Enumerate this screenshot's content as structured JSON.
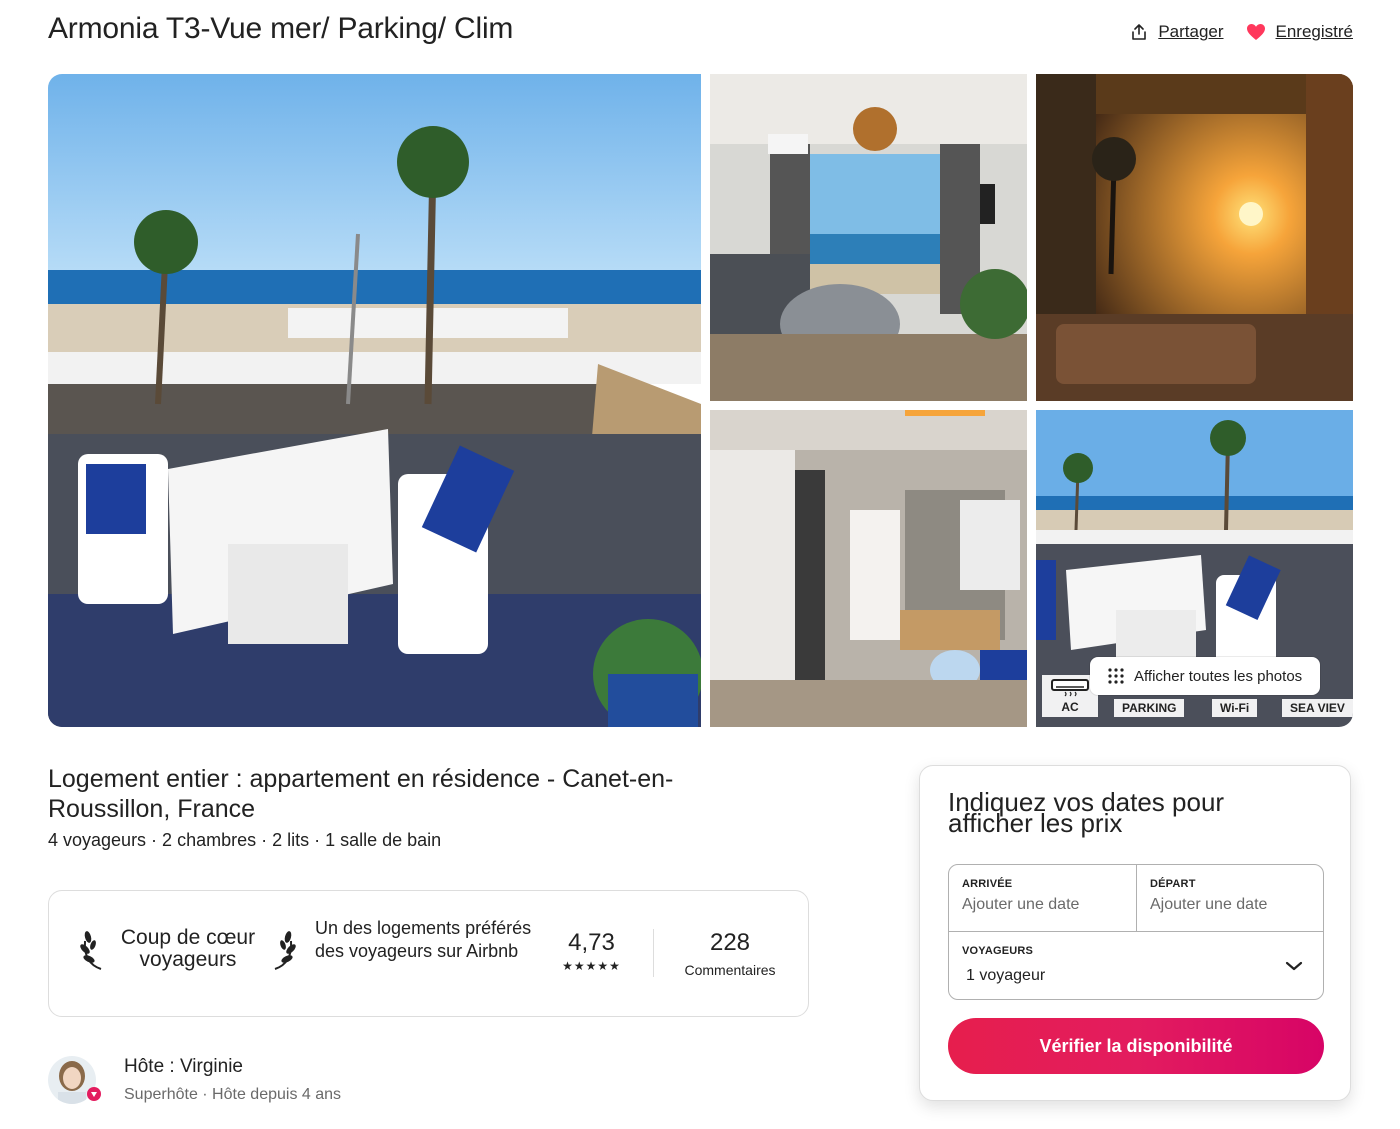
{
  "listing": {
    "title": "Armonia T3-Vue mer/ Parking/ Clim",
    "subtitle": "Logement entier : appartement en résidence - Canet-en-Roussillon, France",
    "details": "4 voyageurs · 2 chambres · 2 lits · 1 salle de bain"
  },
  "header": {
    "share_label": "Partager",
    "saved_label": "Enregistré",
    "icons": [
      "share-icon",
      "heart-icon"
    ],
    "heart_color": "#ff385c"
  },
  "gallery": {
    "show_all_label": "Afficher toutes les photos",
    "amenities": {
      "ac": "AC",
      "parking": "PARKING",
      "wifi": "Wi-Fi",
      "sea": "SEA VIEV"
    }
  },
  "guest_favorite": {
    "badge": "Coup de cœur voyageurs",
    "description": "Un des logements préférés des voyageurs sur Airbnb",
    "rating": "4,73",
    "stars": 5,
    "reviews_count": "228",
    "reviews_label": "Commentaires"
  },
  "host": {
    "name": "Hôte : Virginie",
    "subtitle": "Superhôte · Hôte depuis 4 ans"
  },
  "booking": {
    "title": "Indiquez vos dates pour afficher les prix",
    "checkin_label": "ARRIVÉE",
    "checkin_placeholder": "Ajouter une date",
    "checkout_label": "DÉPART",
    "checkout_placeholder": "Ajouter une date",
    "guests_label": "VOYAGEURS",
    "guests_value": "1 voyageur",
    "button_label": "Vérifier la disponibilité",
    "button_color": "#e31c5f"
  }
}
